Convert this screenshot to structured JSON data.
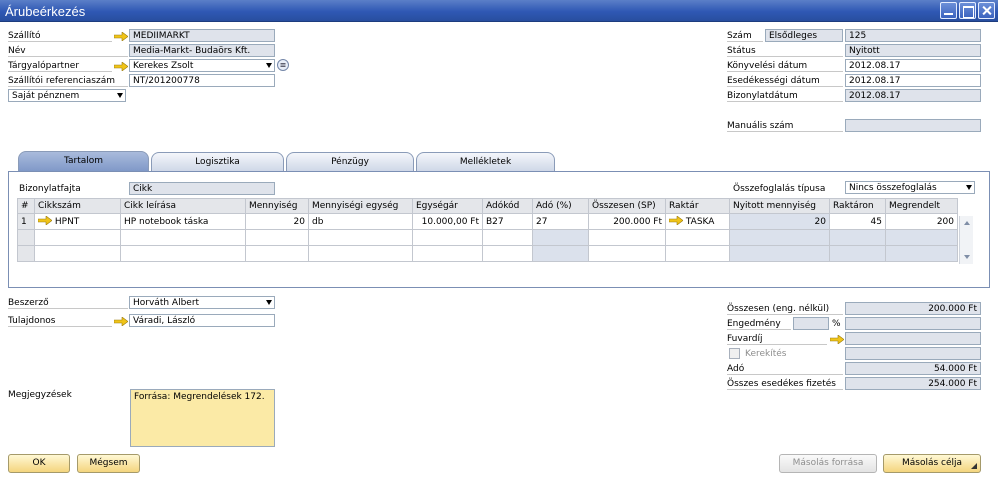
{
  "window": {
    "title": "Árubeérkezés"
  },
  "header_left": {
    "supplier_label": "Szállító",
    "supplier_value": "MEDIIMARKT",
    "name_label": "Név",
    "name_value": "Media-Markt- Budaörs Kft.",
    "contact_label": "Tárgyalópartner",
    "contact_value": "Kerekes Zsolt",
    "ref_label": "Szállítói referenciaszám",
    "ref_value": "NT/201200778",
    "currency_value": "Saját pénznem"
  },
  "header_right": {
    "number_label": "Szám",
    "series_value": "Elsődleges",
    "number_value": "125",
    "status_label": "Státus",
    "status_value": "Nyitott",
    "posting_label": "Könyvelési dátum",
    "posting_value": "2012.08.17",
    "due_label": "Esedékességi dátum",
    "due_value": "2012.08.17",
    "docdate_label": "Bizonylatdátum",
    "docdate_value": "2012.08.17",
    "manual_label": "Manuális szám",
    "manual_value": ""
  },
  "tabs": [
    "Tartalom",
    "Logisztika",
    "Pénzügy",
    "Mellékletek"
  ],
  "content": {
    "doctype_label": "Bizonylatfajta",
    "doctype_value": "Cikk",
    "summary_label": "Összefoglalás típusa",
    "summary_value": "Nincs összefoglalás"
  },
  "table": {
    "columns": [
      "#",
      "Cikkszám",
      "Cikk leírása",
      "Mennyiség",
      "Mennyiségi egység",
      "Egységár",
      "Adókód",
      "Adó (%)",
      "Összesen (SP)",
      "Raktár",
      "Nyitott mennyiség",
      "Raktáron",
      "Megrendelt"
    ],
    "rows": [
      [
        "1",
        "HPNT",
        "HP notebook táska",
        "20",
        "db",
        "10.000,00 Ft",
        "B27",
        "27",
        "200.000 Ft",
        "TASKA",
        "20",
        "45",
        "200"
      ]
    ]
  },
  "footer_left": {
    "buyer_label": "Beszerző",
    "buyer_value": "Horváth Albert",
    "owner_label": "Tulajdonos",
    "owner_value": "Váradi, László",
    "remarks_label": "Megjegyzések",
    "remarks_value": "Forrása: Megrendelések 172."
  },
  "totals": {
    "before_label": "Összesen (eng. nélkül)",
    "before_value": "200.000 Ft",
    "discount_label": "Engedmény",
    "discount_pct_sign": "%",
    "discount_value": "",
    "freight_label": "Fuvardíj",
    "freight_value": "",
    "rounding_label": "Kerekítés",
    "rounding_value": "",
    "tax_label": "Adó",
    "tax_value": "54.000 Ft",
    "total_label": "Összes esedékes fizetés",
    "total_value": "254.000 Ft"
  },
  "buttons": {
    "ok": "OK",
    "cancel": "Mégsem",
    "copy_from": "Másolás forrása",
    "copy_to": "Másolás célja"
  },
  "colors": {
    "title_bar": "#2f58b4",
    "link_arrow": "#f0c419",
    "readonly_field": "#dfe3eb",
    "remarks_bg": "#fbeaa6"
  }
}
